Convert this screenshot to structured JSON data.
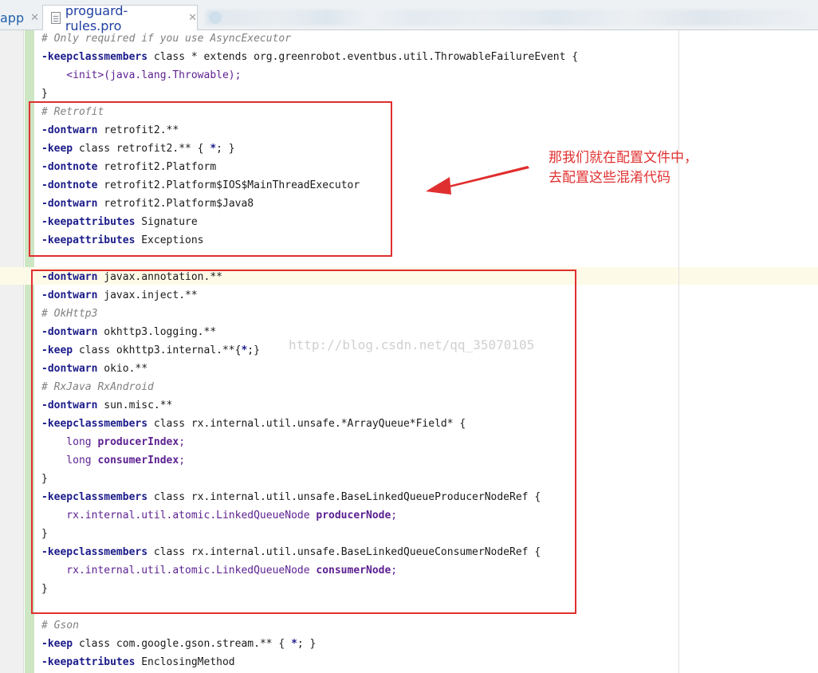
{
  "tabs": [
    {
      "label": "app",
      "active": false
    },
    {
      "label": "proguard-rules.pro",
      "active": true
    }
  ],
  "annotation": {
    "lines": [
      "那我们就在配置文件中，",
      "去配置这些混淆代码"
    ],
    "color": "#e03030"
  },
  "watermark": "http://blog.csdn.net/qq_35070105",
  "code_lines": [
    [
      {
        "t": "# Only required if you use AsyncExecutor",
        "c": "cm"
      }
    ],
    [
      {
        "t": "-keepclassmembers",
        "c": "kw"
      },
      {
        "t": " class * extends org.greenrobot.eventbus.util.ThrowableFailureEvent {",
        "c": ""
      }
    ],
    [
      {
        "t": "    <init>(java.lang.Throwable);",
        "c": "pp"
      }
    ],
    [
      {
        "t": "}",
        "c": ""
      }
    ],
    [
      {
        "t": "# Retrofit",
        "c": "cm"
      }
    ],
    [
      {
        "t": "-dontwarn",
        "c": "kw"
      },
      {
        "t": " retrofit2.**",
        "c": ""
      }
    ],
    [
      {
        "t": "-keep",
        "c": "kw"
      },
      {
        "t": " class retrofit2.** { ",
        "c": ""
      },
      {
        "t": "*",
        "c": "br"
      },
      {
        "t": "; }",
        "c": ""
      }
    ],
    [
      {
        "t": "-dontnote",
        "c": "kw"
      },
      {
        "t": " retrofit2.Platform",
        "c": ""
      }
    ],
    [
      {
        "t": "-dontnote",
        "c": "kw"
      },
      {
        "t": " retrofit2.Platform$IOS$MainThreadExecutor",
        "c": ""
      }
    ],
    [
      {
        "t": "-dontwarn",
        "c": "kw"
      },
      {
        "t": " retrofit2.Platform$Java8",
        "c": ""
      }
    ],
    [
      {
        "t": "-keepattributes",
        "c": "kw"
      },
      {
        "t": " Signature",
        "c": ""
      }
    ],
    [
      {
        "t": "-keepattributes",
        "c": "kw"
      },
      {
        "t": " Exceptions",
        "c": ""
      }
    ],
    [
      {
        "t": "",
        "c": ""
      }
    ],
    [
      {
        "t": "-dontwarn",
        "c": "kw"
      },
      {
        "t": " javax.annotation.**",
        "c": ""
      }
    ],
    [
      {
        "t": "-dontwarn",
        "c": "kw"
      },
      {
        "t": " javax.inject.**",
        "c": ""
      }
    ],
    [
      {
        "t": "# OkHttp3",
        "c": "cm"
      }
    ],
    [
      {
        "t": "-dontwarn",
        "c": "kw"
      },
      {
        "t": " okhttp3.logging.**",
        "c": ""
      }
    ],
    [
      {
        "t": "-keep",
        "c": "kw"
      },
      {
        "t": " class okhttp3.internal.**{",
        "c": ""
      },
      {
        "t": "*",
        "c": "br"
      },
      {
        "t": ";}",
        "c": ""
      }
    ],
    [
      {
        "t": "-dontwarn",
        "c": "kw"
      },
      {
        "t": " okio.**",
        "c": ""
      }
    ],
    [
      {
        "t": "# RxJava RxAndroid",
        "c": "cm"
      }
    ],
    [
      {
        "t": "-dontwarn",
        "c": "kw"
      },
      {
        "t": " sun.misc.**",
        "c": ""
      }
    ],
    [
      {
        "t": "-keepclassmembers",
        "c": "kw"
      },
      {
        "t": " class rx.internal.util.unsafe.*ArrayQueue*Field* {",
        "c": ""
      }
    ],
    [
      {
        "t": "    long ",
        "c": "pp"
      },
      {
        "t": "producerIndex",
        "c": "ppb"
      },
      {
        "t": ";",
        "c": "pp"
      }
    ],
    [
      {
        "t": "    long ",
        "c": "pp"
      },
      {
        "t": "consumerIndex",
        "c": "ppb"
      },
      {
        "t": ";",
        "c": "pp"
      }
    ],
    [
      {
        "t": "}",
        "c": ""
      }
    ],
    [
      {
        "t": "-keepclassmembers",
        "c": "kw"
      },
      {
        "t": " class rx.internal.util.unsafe.BaseLinkedQueueProducerNodeRef {",
        "c": ""
      }
    ],
    [
      {
        "t": "    rx.internal.util.atomic.LinkedQueueNode ",
        "c": "pp"
      },
      {
        "t": "producerNode",
        "c": "ppb"
      },
      {
        "t": ";",
        "c": "pp"
      }
    ],
    [
      {
        "t": "}",
        "c": ""
      }
    ],
    [
      {
        "t": "-keepclassmembers",
        "c": "kw"
      },
      {
        "t": " class rx.internal.util.unsafe.BaseLinkedQueueConsumerNodeRef {",
        "c": ""
      }
    ],
    [
      {
        "t": "    rx.internal.util.atomic.LinkedQueueNode ",
        "c": "pp"
      },
      {
        "t": "consumerNode",
        "c": "ppb"
      },
      {
        "t": ";",
        "c": "pp"
      }
    ],
    [
      {
        "t": "}",
        "c": ""
      }
    ],
    [
      {
        "t": "",
        "c": ""
      }
    ],
    [
      {
        "t": "# Gson",
        "c": "cm"
      }
    ],
    [
      {
        "t": "-keep",
        "c": "kw"
      },
      {
        "t": " class com.google.gson.stream.** { ",
        "c": ""
      },
      {
        "t": "*",
        "c": "br"
      },
      {
        "t": "; }",
        "c": ""
      }
    ],
    [
      {
        "t": "-keepattributes",
        "c": "kw"
      },
      {
        "t": " EnclosingMethod",
        "c": ""
      }
    ]
  ]
}
